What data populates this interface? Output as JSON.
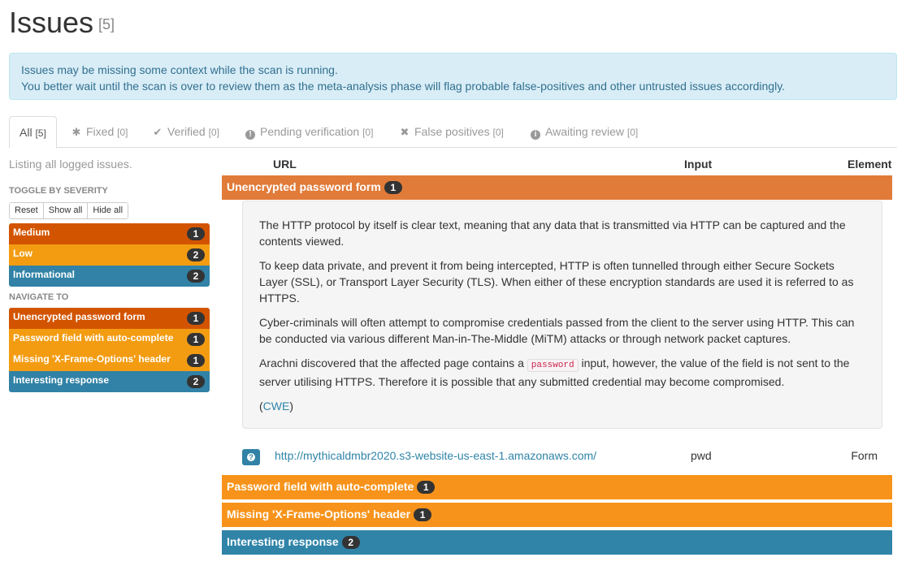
{
  "page": {
    "title": "Issues",
    "count": "[5]"
  },
  "alert": {
    "line1": "Issues may be missing some context while the scan is running.",
    "line2": "You better wait until the scan is over to review them as the meta-analysis phase will flag probable false-positives and other untrusted issues accordingly."
  },
  "tabs": [
    {
      "label": "All",
      "count": "[5]",
      "icon": ""
    },
    {
      "label": "Fixed",
      "count": "[0]",
      "icon": "asterisk-icon"
    },
    {
      "label": "Verified",
      "count": "[0]",
      "icon": "check-icon"
    },
    {
      "label": "Pending verification",
      "count": "[0]",
      "icon": "exclamation-circle-icon"
    },
    {
      "label": "False positives",
      "count": "[0]",
      "icon": "x-icon"
    },
    {
      "label": "Awaiting review",
      "count": "[0]",
      "icon": "info-circle-icon"
    }
  ],
  "sidebar": {
    "listing": "Listing all logged issues.",
    "toggle_heading": "TOGGLE BY SEVERITY",
    "buttons": {
      "reset": "Reset",
      "show_all": "Show all",
      "hide_all": "Hide all"
    },
    "severities": [
      {
        "label": "Medium",
        "count": "1"
      },
      {
        "label": "Low",
        "count": "2"
      },
      {
        "label": "Informational",
        "count": "2"
      }
    ],
    "navigate_heading": "NAVIGATE TO",
    "navigate": [
      {
        "label": "Unencrypted password form",
        "count": "1"
      },
      {
        "label": "Password field with auto-complete",
        "count": "1"
      },
      {
        "label": "Missing 'X-Frame-Options' header",
        "count": "1"
      },
      {
        "label": "Interesting response",
        "count": "2"
      }
    ]
  },
  "columns": {
    "url": "URL",
    "input": "Input",
    "element": "Element"
  },
  "issues": [
    {
      "title": "Unencrypted password form",
      "count": "1"
    },
    {
      "title": "Password field with auto-complete",
      "count": "1"
    },
    {
      "title": "Missing 'X-Frame-Options' header",
      "count": "1"
    },
    {
      "title": "Interesting response",
      "count": "2"
    }
  ],
  "description": {
    "p1": "The HTTP protocol by itself is clear text, meaning that any data that is transmitted via HTTP can be captured and the contents viewed.",
    "p2": "To keep data private, and prevent it from being intercepted, HTTP is often tunnelled through either Secure Sockets Layer (SSL), or Transport Layer Security (TLS). When either of these encryption standards are used it is referred to as HTTPS.",
    "p3": "Cyber-criminals will often attempt to compromise credentials passed from the client to the server using HTTP. This can be conducted via various different Man-in-The-Middle (MiTM) attacks or through network packet captures.",
    "p4_before": "Arachni discovered that the affected page contains a",
    "p4_code": "password",
    "p4_after": "input, however, the value of the field is not sent to the server utilising HTTPS. Therefore it is possible that any submitted credential may become compromised.",
    "ref_open": "(",
    "ref_link": "CWE",
    "ref_close": ")"
  },
  "instance": {
    "url": "http://mythicaldmbr2020.s3-website-us-east-1.amazonaws.com/",
    "input": "pwd",
    "element": "Form"
  },
  "colors": {
    "medium": "#d35400",
    "low": "#f39c12",
    "informational": "#3182a6",
    "link": "#2f84a8"
  }
}
